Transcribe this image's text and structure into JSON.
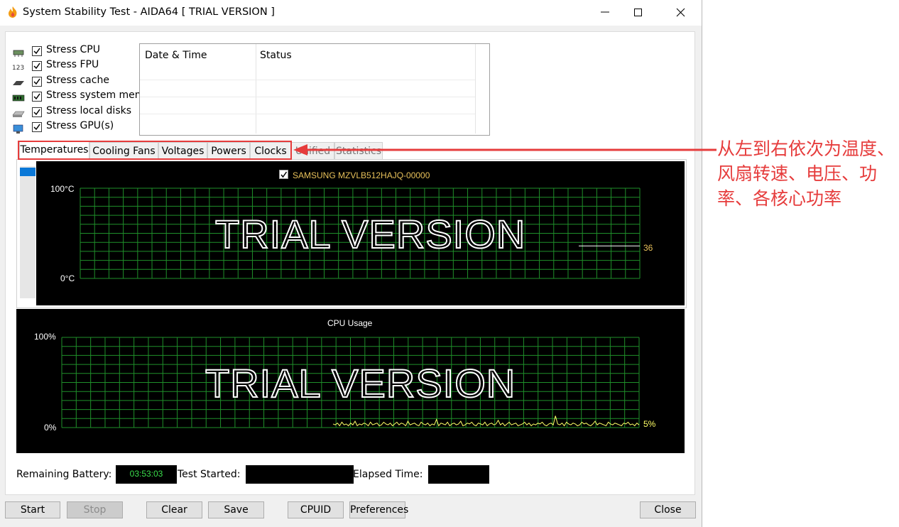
{
  "window": {
    "title": "System Stability Test - AIDA64  [ TRIAL VERSION ]"
  },
  "options": [
    {
      "label": "Stress CPU",
      "checked": true,
      "icon": "cpu-icon"
    },
    {
      "label": "Stress FPU",
      "checked": true,
      "icon": "fpu-icon"
    },
    {
      "label": "Stress cache",
      "checked": true,
      "icon": "cache-icon"
    },
    {
      "label": "Stress system memo",
      "checked": true,
      "icon": "memory-icon"
    },
    {
      "label": "Stress local disks",
      "checked": true,
      "icon": "disk-icon"
    },
    {
      "label": "Stress GPU(s)",
      "checked": true,
      "icon": "gpu-icon"
    }
  ],
  "log": {
    "col_datetime": "Date & Time",
    "col_status": "Status"
  },
  "tabs": [
    {
      "label": "Temperatures",
      "active": true
    },
    {
      "label": "Cooling Fans",
      "active": false
    },
    {
      "label": "Voltages",
      "active": false
    },
    {
      "label": "Powers",
      "active": false
    },
    {
      "label": "Clocks",
      "active": false
    },
    {
      "label": "Unified",
      "active": false
    },
    {
      "label": "Statistics",
      "active": false
    }
  ],
  "temp_graph": {
    "legend_label": "SAMSUNG MZVLB512HAJQ-00000",
    "legend_checked": true,
    "y_max_label": "100°C",
    "y_min_label": "0°C",
    "current_value_label": "36",
    "current_value": 36,
    "watermark": "TRIAL VERSION",
    "line_color": "#ffffff",
    "label_color": "#e8c15a"
  },
  "cpu_graph": {
    "title": "CPU Usage",
    "y_max_label": "100%",
    "y_min_label": "0%",
    "current_value_label": "5%",
    "current_value": 5,
    "watermark": "TRIAL VERSION",
    "line_color": "#ffff66",
    "grid_color": "#1f8f2a",
    "samples": [
      4,
      3,
      5,
      2,
      6,
      3,
      4,
      2,
      5,
      3,
      7,
      2,
      4,
      3,
      5,
      4,
      2,
      6,
      3,
      4,
      5,
      2,
      3,
      6,
      4,
      3,
      5,
      2,
      4,
      6,
      3,
      5,
      4,
      2,
      7,
      3,
      4,
      5,
      3,
      2,
      6,
      4,
      3,
      5,
      2,
      4,
      3,
      9,
      2,
      5,
      4,
      3,
      6,
      2,
      4,
      5,
      3,
      4,
      7,
      2,
      3,
      5,
      4,
      6,
      3,
      2,
      5,
      4,
      3,
      6,
      2,
      4,
      5,
      3,
      4,
      8,
      3,
      5,
      2,
      4,
      6,
      3,
      4,
      5,
      2,
      3,
      4,
      6,
      3,
      5,
      2,
      4,
      3,
      5,
      4,
      6,
      3,
      2,
      4,
      5,
      3,
      13,
      4,
      3,
      5,
      2,
      6,
      4,
      3,
      5,
      4,
      2,
      3,
      6,
      4,
      5,
      3,
      2,
      4,
      7,
      3,
      5,
      4,
      3,
      2,
      6,
      4,
      3,
      5,
      4,
      3,
      2,
      5,
      4,
      6,
      3,
      4,
      2,
      5,
      3
    ]
  },
  "status": {
    "battery_label": "Remaining Battery:",
    "battery_value": "03:53:03",
    "started_label": "Test Started:",
    "started_value": "",
    "elapsed_label": "Elapsed Time:",
    "elapsed_value": ""
  },
  "buttons": {
    "start": "Start",
    "stop": "Stop",
    "clear": "Clear",
    "save": "Save",
    "cpuid": "CPUID",
    "preferences": "Preferences",
    "close": "Close"
  },
  "annotation": {
    "text": "从左到右依次为温度、风扇转速、电压、功率、各核心功率",
    "color": "#e63c3c"
  }
}
